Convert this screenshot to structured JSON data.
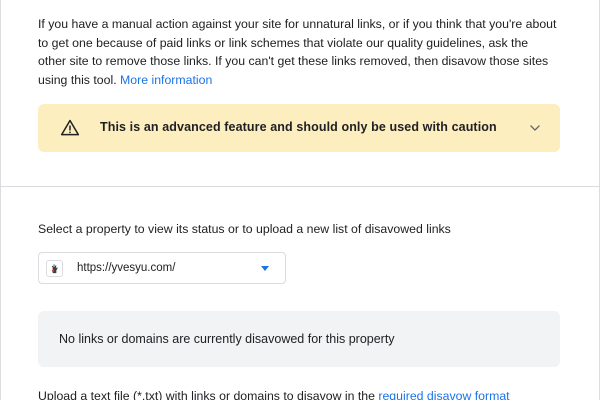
{
  "intro": {
    "text": "If you have a manual action against your site for unnatural links, or if you think that you're about to get one because of paid links or link schemes that violate our quality guidelines, ask the other site to remove those links. If you can't get these links removed, then disavow those sites using this tool.",
    "link_label": "More information"
  },
  "warning": {
    "icon": "warning-triangle-icon",
    "text": "This is an advanced feature and should only be used with caution",
    "expand_icon": "chevron-down-icon",
    "background": "#fdeebf"
  },
  "property": {
    "label": "Select a property to view its status or to upload a new list of disavowed links",
    "selected": "https://yvesyu.com/",
    "favicon": "site-favicon",
    "accent": "#1a73e8"
  },
  "status": {
    "text": "No links or domains are currently disavowed for this property"
  },
  "upload": {
    "text": "Upload a text file (*.txt) with links or domains to disavow in the",
    "link_label": "required disavow format"
  },
  "colors": {
    "link": "#1a73e8",
    "divider": "#dadce0",
    "status_bg": "#f1f3f4"
  }
}
